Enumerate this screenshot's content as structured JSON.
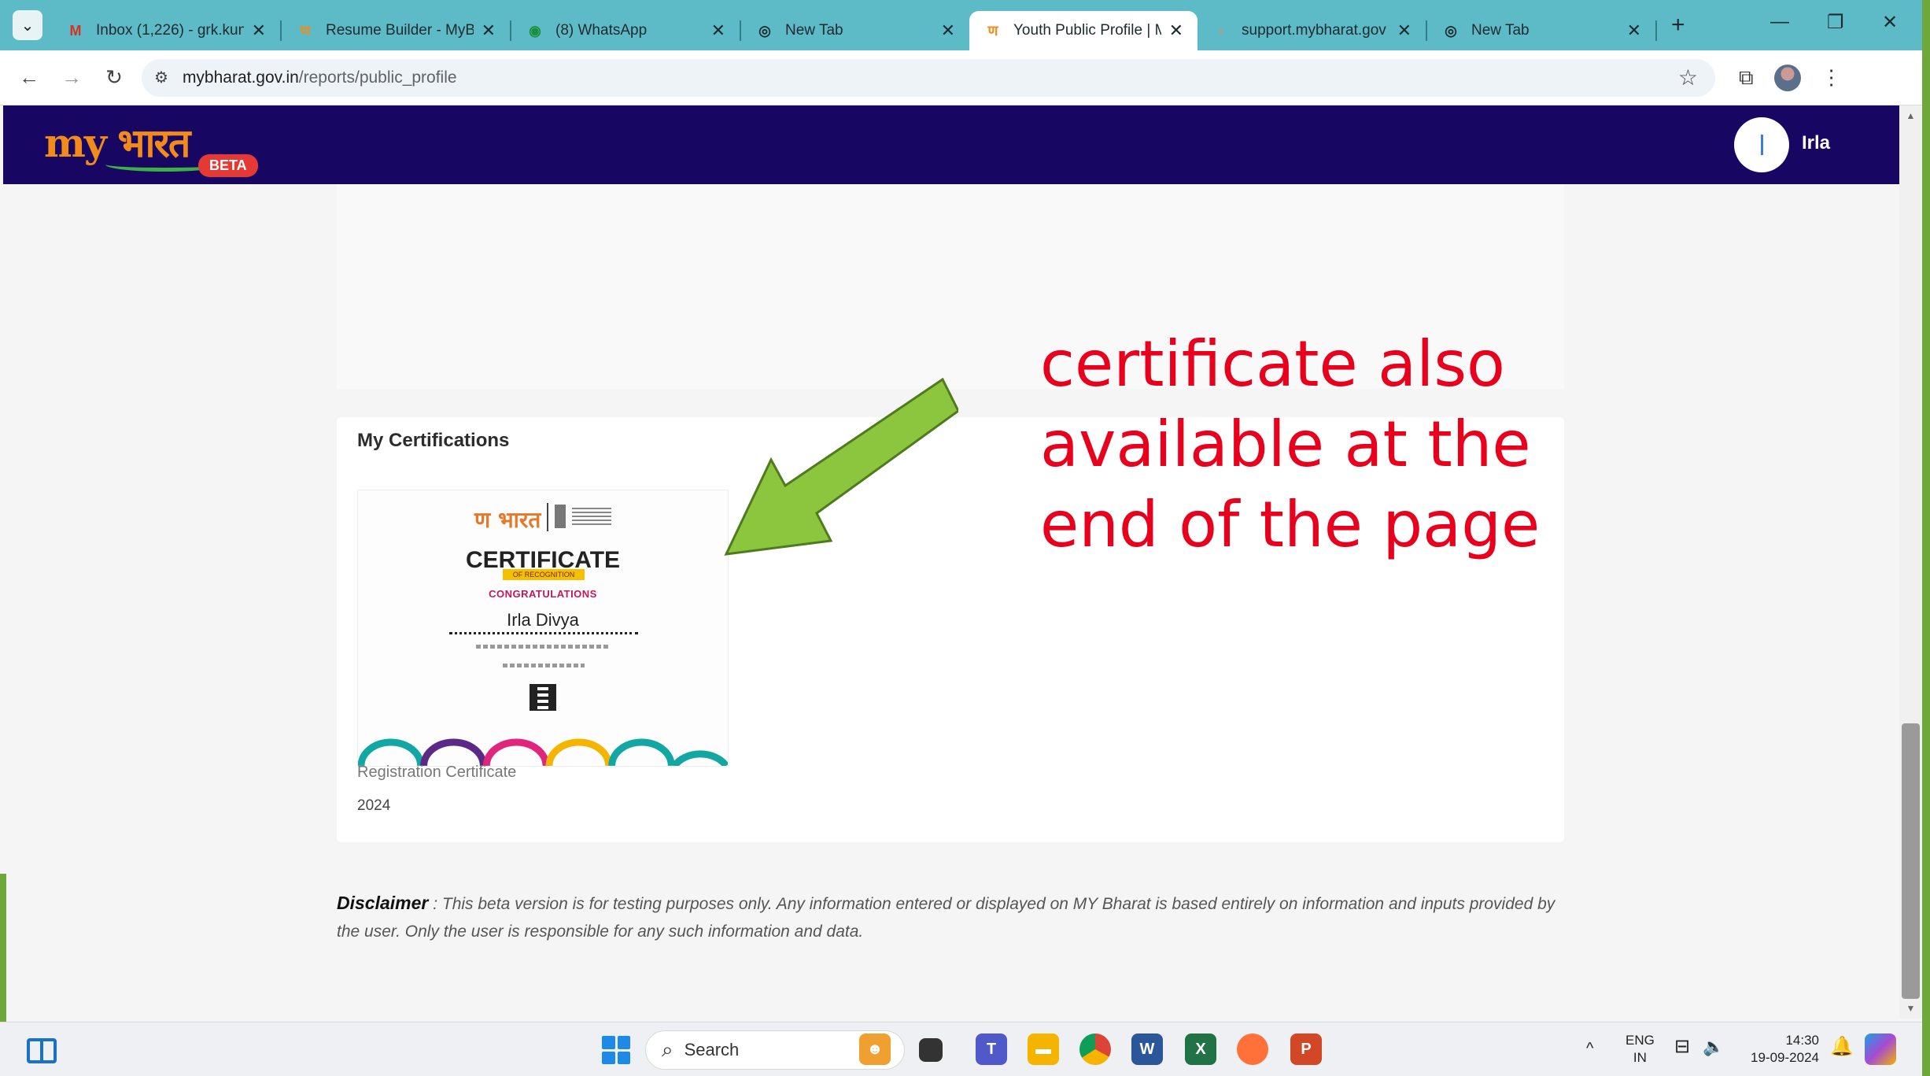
{
  "browser": {
    "tabs": [
      {
        "label": "Inbox (1,226) - grk.kun",
        "icon": "gmail-icon",
        "active": false
      },
      {
        "label": "Resume Builder - MyB",
        "icon": "mybharat-icon",
        "active": false
      },
      {
        "label": "(8) WhatsApp",
        "icon": "whatsapp-icon",
        "active": false
      },
      {
        "label": "New Tab",
        "icon": "chrome-icon",
        "active": false
      },
      {
        "label": "Youth Public Profile | M",
        "icon": "mybharat-icon",
        "active": true
      },
      {
        "label": "support.mybharat.gov",
        "icon": "globe-icon",
        "active": false
      },
      {
        "label": "New Tab",
        "icon": "chrome-icon",
        "active": false
      }
    ],
    "url_host": "mybharat.gov.in",
    "url_path": "/reports/public_profile"
  },
  "site": {
    "logo_text": "my भारत",
    "beta_label": "BETA",
    "user_name": "Irla",
    "header_color": "#180663"
  },
  "certifications": {
    "heading": "My Certifications",
    "items": [
      {
        "thumb_title": "CERTIFICATE",
        "thumb_ribbon": "OF RECOGNITION",
        "thumb_congrats": "CONGRATULATIONS",
        "thumb_name": "Irla Divya",
        "caption": "Registration Certificate",
        "year": "2024"
      }
    ]
  },
  "disclaimer": {
    "label": "Disclaimer",
    "text": " : This beta version is for testing purposes only. Any information entered or displayed on MY Bharat is based entirely on information and inputs provided by the user. Only the user is responsible for any such information and data."
  },
  "annotation": {
    "text": "certificate also available at the end of the page",
    "color": "#e8001c",
    "arrow_color": "#8cc63f"
  },
  "taskbar": {
    "search_placeholder": "Search",
    "language_top": "ENG",
    "language_bottom": "IN",
    "time": "14:30",
    "date": "19-09-2024"
  }
}
